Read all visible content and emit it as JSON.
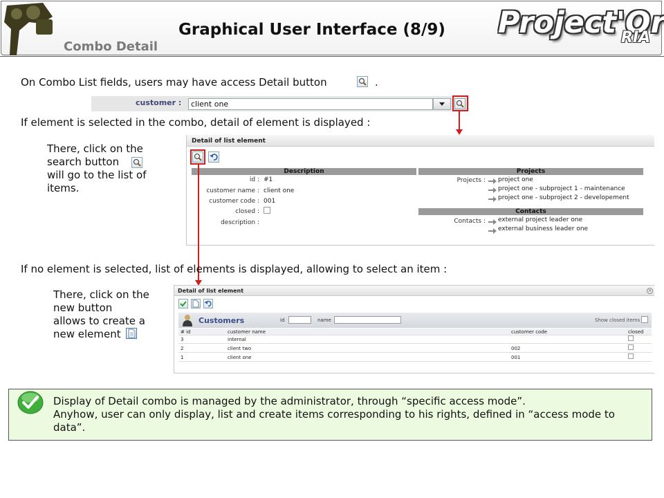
{
  "header": {
    "title": "Graphical User Interface (8/9)",
    "subtitle": "Combo Detail",
    "brand": "Project'Or",
    "brand_suffix": "RIA"
  },
  "intro": {
    "line1": "On Combo List fields, users may have access Detail button",
    "line1_end": ".",
    "line2": "If element is selected in the combo, detail of element is displayed :",
    "line3": "If no element is selected, list of elements is displayed, allowing to select an item :"
  },
  "combo": {
    "label": "customer :",
    "value": "client one"
  },
  "note_search": {
    "line1": "There,  click on the",
    "line2": "search button",
    "line3": "will go to the list of",
    "line4": "items."
  },
  "note_new": {
    "line1": "There, click on the",
    "line2": "new button",
    "line3": "allows to create a",
    "line4": "new element"
  },
  "detail_panel": {
    "title": "Detail of list element",
    "description_header": "Description",
    "projects_header": "Projects",
    "contacts_header": "Contacts",
    "fields": [
      {
        "label": "id :",
        "value": "#1"
      },
      {
        "label": "customer name :",
        "value": "client one"
      },
      {
        "label": "customer code :",
        "value": "001"
      },
      {
        "label": "closed :",
        "value": ""
      },
      {
        "label": "description :",
        "value": ""
      }
    ],
    "projects_label": "Projects :",
    "projects": [
      "project one",
      "project one - subproject 1 - maintenance",
      "project one - subproject 2 - developement"
    ],
    "contacts_label": "Contacts :",
    "contacts": [
      "external project leader one",
      "external business leader one"
    ]
  },
  "list_panel": {
    "title": "Detail of list element",
    "section_title": "Customers",
    "id_filter_label": "id",
    "name_filter_label": "name",
    "show_closed_label": "Show closed items",
    "columns": [
      "# id",
      "customer name",
      "customer code",
      "closed"
    ],
    "rows": [
      {
        "id": "3",
        "name": "internal",
        "code": ""
      },
      {
        "id": "2",
        "name": "client two",
        "code": "002"
      },
      {
        "id": "1",
        "name": "client one",
        "code": "001"
      }
    ]
  },
  "info": {
    "line1": "Display of Detail combo is managed by the administrator, through “specific access mode”.",
    "line2": "Anyhow, user can only display, list and create items corresponding to his rights, defined in “access mode to data”."
  },
  "colors": {
    "highlight_red": "#d21e1e",
    "info_bg": "#ecfadf",
    "section_bar": "#9a9a9a",
    "customers_title": "#3c4e8a"
  }
}
